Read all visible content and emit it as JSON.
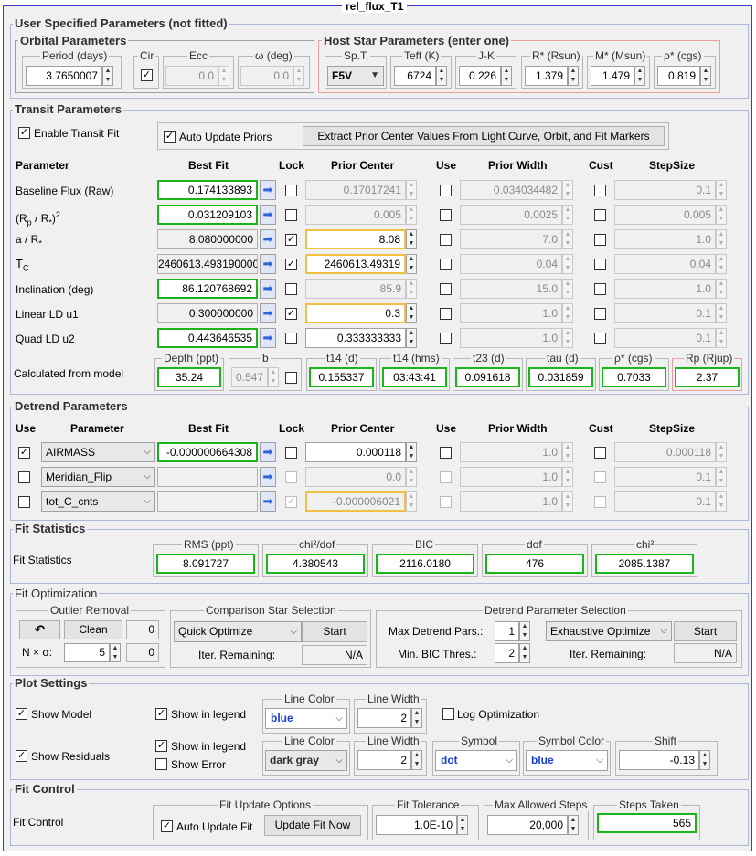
{
  "window_title": "rel_flux_T1",
  "user_params": {
    "title": "User Specified Parameters (not fitted)",
    "orbital": {
      "title": "Orbital Parameters",
      "period_label": "Period (days)",
      "period": "3.7650007",
      "cir_label": "Cir",
      "ecc_label": "Ecc",
      "ecc": "0.0",
      "omega_label": "ω (deg)",
      "omega": "0.0"
    },
    "host": {
      "title": "Host Star Parameters (enter one)",
      "spt_label": "Sp.T.",
      "spt": "F5V",
      "teff_label": "Teff (K)",
      "teff": "6724",
      "jk_label": "J-K",
      "jk": "0.226",
      "rstar_label": "R* (Rsun)",
      "rstar": "1.379",
      "mstar_label": "M* (Msun)",
      "mstar": "1.479",
      "rho_label": "ρ* (cgs)",
      "rho": "0.819"
    }
  },
  "transit": {
    "title": "Transit Parameters",
    "enable_label": "Enable Transit Fit",
    "auto_priors_label": "Auto Update Priors",
    "extract_button": "Extract Prior Center Values From Light Curve, Orbit, and Fit Markers",
    "headers": {
      "parameter": "Parameter",
      "best_fit": "Best Fit",
      "lock": "Lock",
      "prior_center": "Prior Center",
      "use": "Use",
      "prior_width": "Prior Width",
      "cust": "Cust",
      "stepsize": "StepSize"
    },
    "rows": [
      {
        "name": "Baseline Flux (Raw)",
        "best_fit": "0.174133893",
        "prior_center": "0.17017241",
        "prior_width": "0.034034482",
        "stepsize": "0.1"
      },
      {
        "name": "(R",
        "sub": "p",
        "mid": " / R",
        "sub2": "*",
        "sup": "2",
        "close": ")",
        "best_fit": "0.031209103",
        "prior_center": "0.005",
        "prior_width": "0.0025",
        "stepsize": "0.005"
      },
      {
        "name": "a / R",
        "sub": "*",
        "best_fit": "8.080000000",
        "prior_center": "8.08",
        "prior_width": "7.0",
        "stepsize": "1.0"
      },
      {
        "name": "T",
        "sub": "C",
        "best_fit": "2460613.493190000",
        "prior_center": "2460613.49319",
        "prior_width": "0.04",
        "stepsize": "0.04"
      },
      {
        "name": "Inclination (deg)",
        "best_fit": "86.120768692",
        "prior_center": "85.9",
        "prior_width": "15.0",
        "stepsize": "1.0"
      },
      {
        "name": "Linear LD u1",
        "best_fit": "0.300000000",
        "prior_center": "0.3",
        "prior_width": "1.0",
        "stepsize": "0.1"
      },
      {
        "name": "Quad LD u2",
        "best_fit": "0.443646535",
        "prior_center": "0.333333333",
        "prior_width": "1.0",
        "stepsize": "0.1"
      }
    ],
    "calc": {
      "label": "Calculated from model",
      "depth_label": "Depth (ppt)",
      "depth": "35.24",
      "b_label": "b",
      "b": "0.547",
      "t14_label": "t14 (d)",
      "t14": "0.155337",
      "t14hms_label": "t14 (hms)",
      "t14hms": "03:43:41",
      "t23_label": "t23 (d)",
      "t23": "0.091618",
      "tau_label": "tau (d)",
      "tau": "0.031859",
      "rho_label": "ρ* (cgs)",
      "rho": "0.7033",
      "rp_label": "Rp (Rjup)",
      "rp": "2.37"
    }
  },
  "detrend": {
    "title": "Detrend Parameters",
    "headers": {
      "use": "Use",
      "parameter": "Parameter",
      "best_fit": "Best Fit",
      "lock": "Lock",
      "prior_center": "Prior Center",
      "use2": "Use",
      "prior_width": "Prior Width",
      "cust": "Cust",
      "stepsize": "StepSize"
    },
    "rows": [
      {
        "param": "AIRMASS",
        "best_fit": "-0.000000664308",
        "prior_center": "0.000118",
        "prior_width": "1.0",
        "stepsize": "0.000118"
      },
      {
        "param": "Meridian_Flip",
        "best_fit": "",
        "prior_center": "0.0",
        "prior_width": "1.0",
        "stepsize": "0.1"
      },
      {
        "param": "tot_C_cnts",
        "best_fit": "",
        "prior_center": "-0.000006021",
        "prior_width": "1.0",
        "stepsize": "0.1"
      }
    ]
  },
  "fit_stats": {
    "title": "Fit Statistics",
    "label": "Fit Statistics",
    "rms_label": "RMS (ppt)",
    "rms": "8.091727",
    "chi2dof_label": "chi²/dof",
    "chi2dof": "4.380543",
    "bic_label": "BIC",
    "bic": "2116.0180",
    "dof_label": "dof",
    "dof": "476",
    "chi2_label": "chi²",
    "chi2": "2085.1387"
  },
  "fit_opt": {
    "title": "Fit Optimization",
    "outlier": {
      "title": "Outlier Removal",
      "undo": "↶",
      "clean": "Clean",
      "count1": "0",
      "nsigma_label": "N × σ:",
      "nsigma": "5",
      "count2": "0"
    },
    "comp": {
      "title": "Comparison Star Selection",
      "mode": "Quick Optimize",
      "start": "Start",
      "iter_label": "Iter. Remaining:",
      "iter": "N/A"
    },
    "detrend_sel": {
      "title": "Detrend Parameter Selection",
      "max_label": "Max Detrend Pars.:",
      "max": "1",
      "mode": "Exhaustive Optimize",
      "start": "Start",
      "minbic_label": "Min. BIC Thres.:",
      "minbic": "2",
      "iter_label": "Iter. Remaining:",
      "iter": "N/A"
    }
  },
  "plot": {
    "title": "Plot Settings",
    "show_model": "Show Model",
    "show_legend1": "Show in legend",
    "line_color_label": "Line Color",
    "line_color1": "blue",
    "line_width_label": "Line Width",
    "line_width1": "2",
    "log_opt": "Log Optimization",
    "show_residuals": "Show Residuals",
    "show_legend2": "Show in legend",
    "show_error": "Show Error",
    "line_color2": "dark gray",
    "line_width2": "2",
    "symbol_label": "Symbol",
    "symbol": "dot",
    "symbol_color_label": "Symbol Color",
    "symbol_color": "blue",
    "shift_label": "Shift",
    "shift": "-0.13"
  },
  "fit_control": {
    "title": "Fit Control",
    "label": "Fit Control",
    "update_opts_label": "Fit Update Options",
    "auto_update": "Auto Update Fit",
    "update_now": "Update Fit Now",
    "tol_label": "Fit Tolerance",
    "tol": "1.0E-10",
    "max_steps_label": "Max Allowed Steps",
    "max_steps": "20,000",
    "steps_label": "Steps Taken",
    "steps": "565"
  },
  "colors": {
    "green": "#19b619",
    "yellow": "#f0c040",
    "blue_text": "#1a3fd0",
    "border": "#3b3bd0"
  }
}
